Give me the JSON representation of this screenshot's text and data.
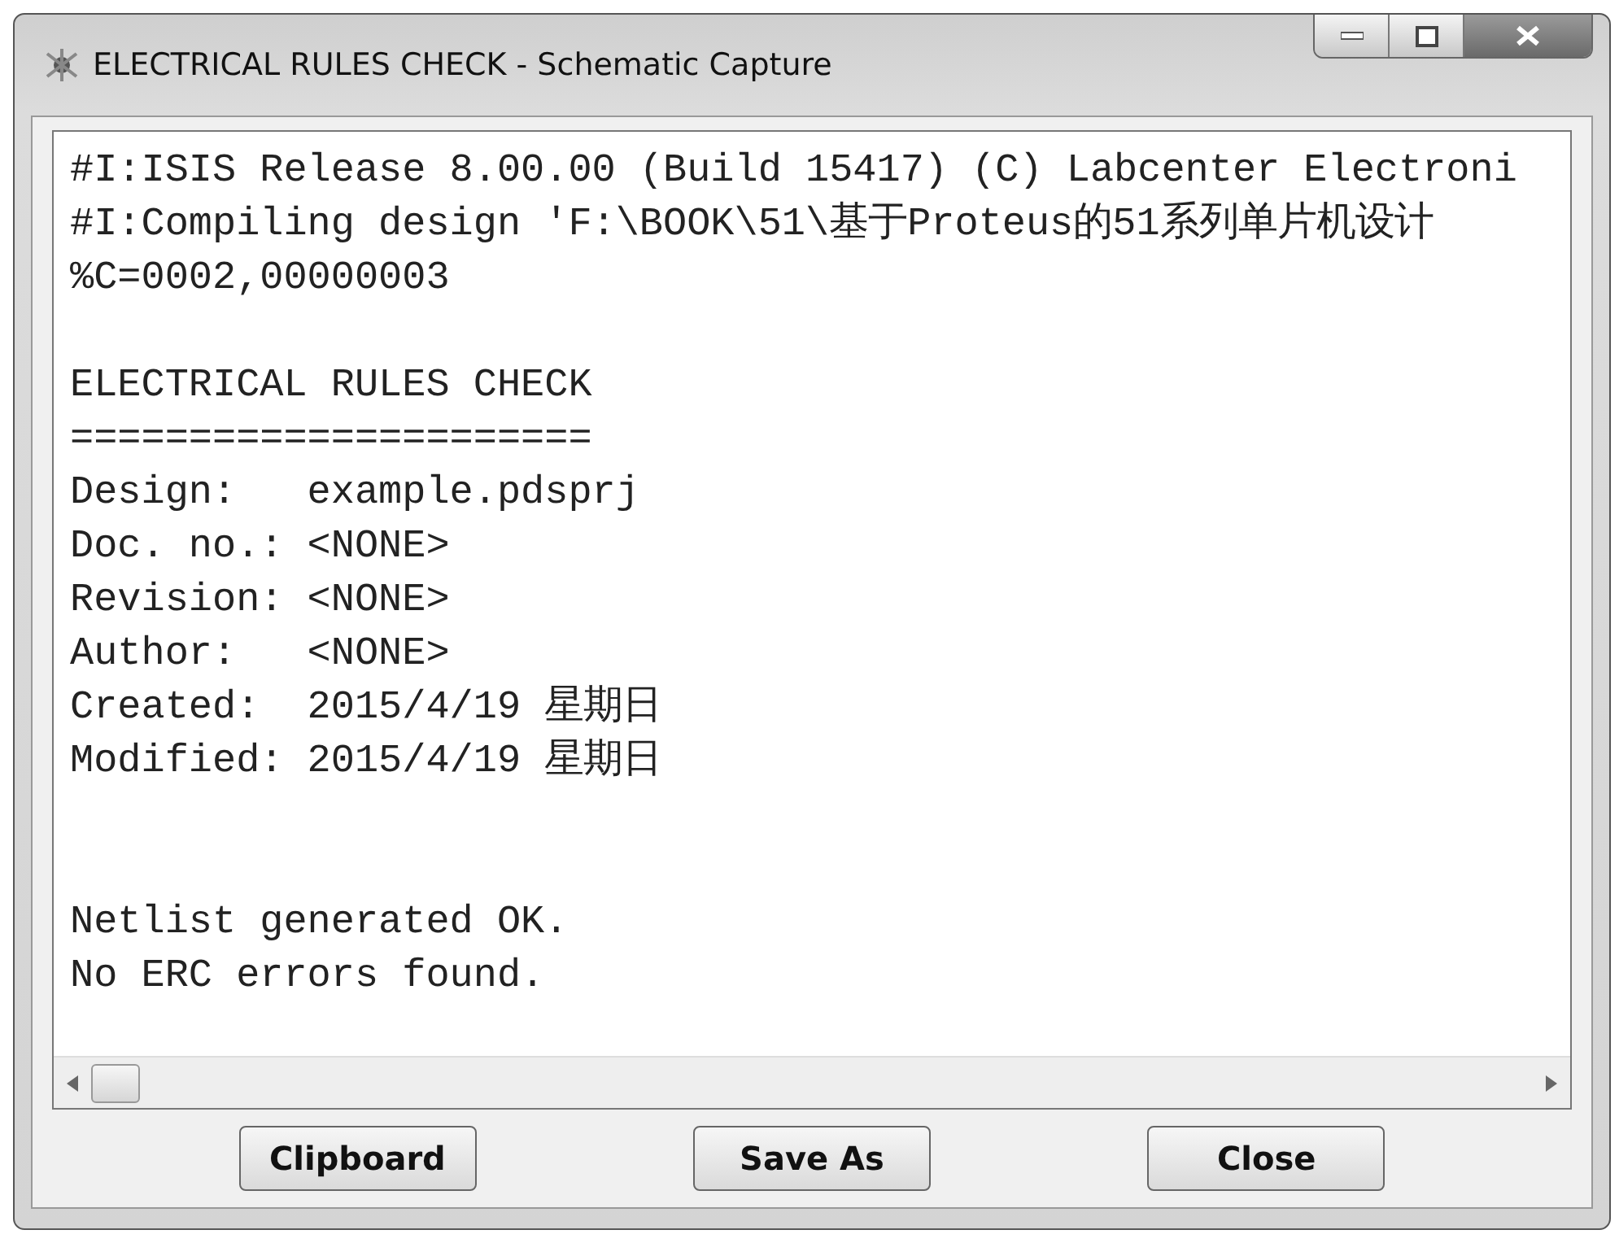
{
  "window": {
    "title": "ELECTRICAL RULES CHECK - Schematic Capture"
  },
  "log": [
    {
      "kind": "text",
      "text": "#I:ISIS Release 8.00.00 (Build 15417) (C) Labcenter Electroni"
    },
    {
      "kind": "text",
      "text": "#I:Compiling design 'F:\\BOOK\\51\\基于Proteus的51系列单片机设计"
    },
    {
      "kind": "text",
      "text": "%C=0002,00000003"
    },
    {
      "kind": "blank"
    },
    {
      "kind": "text",
      "text": "ELECTRICAL RULES CHECK"
    },
    {
      "kind": "text",
      "text": "======================"
    },
    {
      "kind": "text",
      "text": "Design:   example.pdsprj"
    },
    {
      "kind": "text",
      "text": "Doc. no.: <NONE>"
    },
    {
      "kind": "text",
      "text": "Revision: <NONE>"
    },
    {
      "kind": "text",
      "text": "Author:   <NONE>"
    },
    {
      "kind": "text",
      "text": "Created:  2015/4/19 星期日"
    },
    {
      "kind": "text",
      "text": "Modified: 2015/4/19 星期日"
    },
    {
      "kind": "blank"
    },
    {
      "kind": "blank"
    },
    {
      "kind": "text",
      "text": "Netlist generated OK."
    },
    {
      "kind": "text",
      "text": "No ERC errors found."
    }
  ],
  "buttons": [
    {
      "label": "Clipboard"
    },
    {
      "label": "Save As"
    },
    {
      "label": "Close"
    }
  ]
}
